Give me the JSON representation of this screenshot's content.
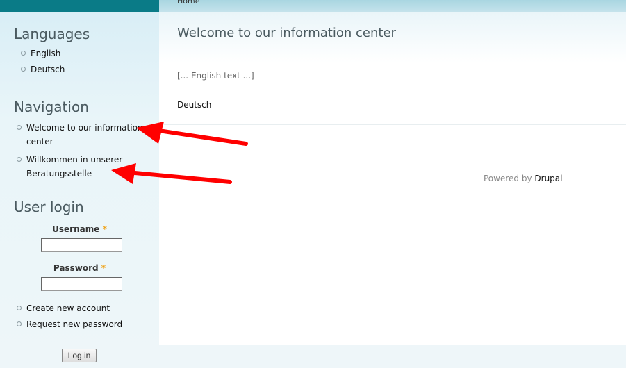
{
  "breadcrumb": {
    "home": "Home"
  },
  "languages": {
    "title": "Languages",
    "items": [
      "English",
      "Deutsch"
    ]
  },
  "navigation": {
    "title": "Navigation",
    "items": [
      {
        "line1": "Welcome to our information",
        "line2": "center"
      },
      {
        "line1": "Willkommen in unserer",
        "line2": "Beratungsstelle"
      }
    ]
  },
  "user_login": {
    "title": "User login",
    "username_label": "Username",
    "password_label": "Password",
    "required_mark": "*",
    "links": [
      "Create new account",
      "Request new password"
    ],
    "login_button": "Log in"
  },
  "main": {
    "title": "Welcome to our information center",
    "body": "[... English text ...]",
    "translation_link": "Deutsch"
  },
  "footer": {
    "powered_by": "Powered by",
    "brand": "Drupal"
  },
  "colors": {
    "topbar_accent": "#0a7b87",
    "annotation_arrow": "#ff0000",
    "required_mark": "#f0a010"
  }
}
